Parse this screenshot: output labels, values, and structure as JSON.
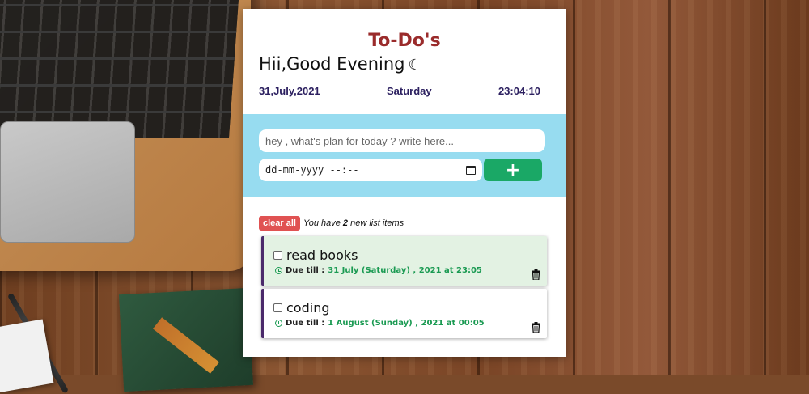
{
  "app": {
    "title": "To-Do's",
    "greeting": "Hii,Good Evening",
    "greeting_icon": "moon-icon",
    "date": "31,July,2021",
    "day": "Saturday",
    "time": "23:04:10"
  },
  "entry": {
    "task_placeholder": "hey , what's plan for today ? write here...",
    "task_value": "",
    "datetime_placeholder": "dd-mm-yyyy --:--",
    "datetime_icon": "calendar-icon",
    "add_label": "+"
  },
  "list": {
    "clear_label": "clear all",
    "count_prefix": "You have",
    "count": "2",
    "count_suffix": "new list items",
    "due_label": "Due till :",
    "items": [
      {
        "title": "read books",
        "due": "31 July (Saturday) , 2021 at 23:05",
        "checked": false,
        "highlighted": true
      },
      {
        "title": "coding",
        "due": "1 August (Sunday) , 2021 at 00:05",
        "checked": false,
        "highlighted": false
      }
    ]
  },
  "colors": {
    "title": "#9a2b2b",
    "entry_bg": "#97dcf0",
    "add_button": "#1aa866",
    "clear_button": "#e05252",
    "due_date": "#1a9a52",
    "item_border": "#4b2a6b",
    "highlight_bg": "#e3f2e3"
  }
}
